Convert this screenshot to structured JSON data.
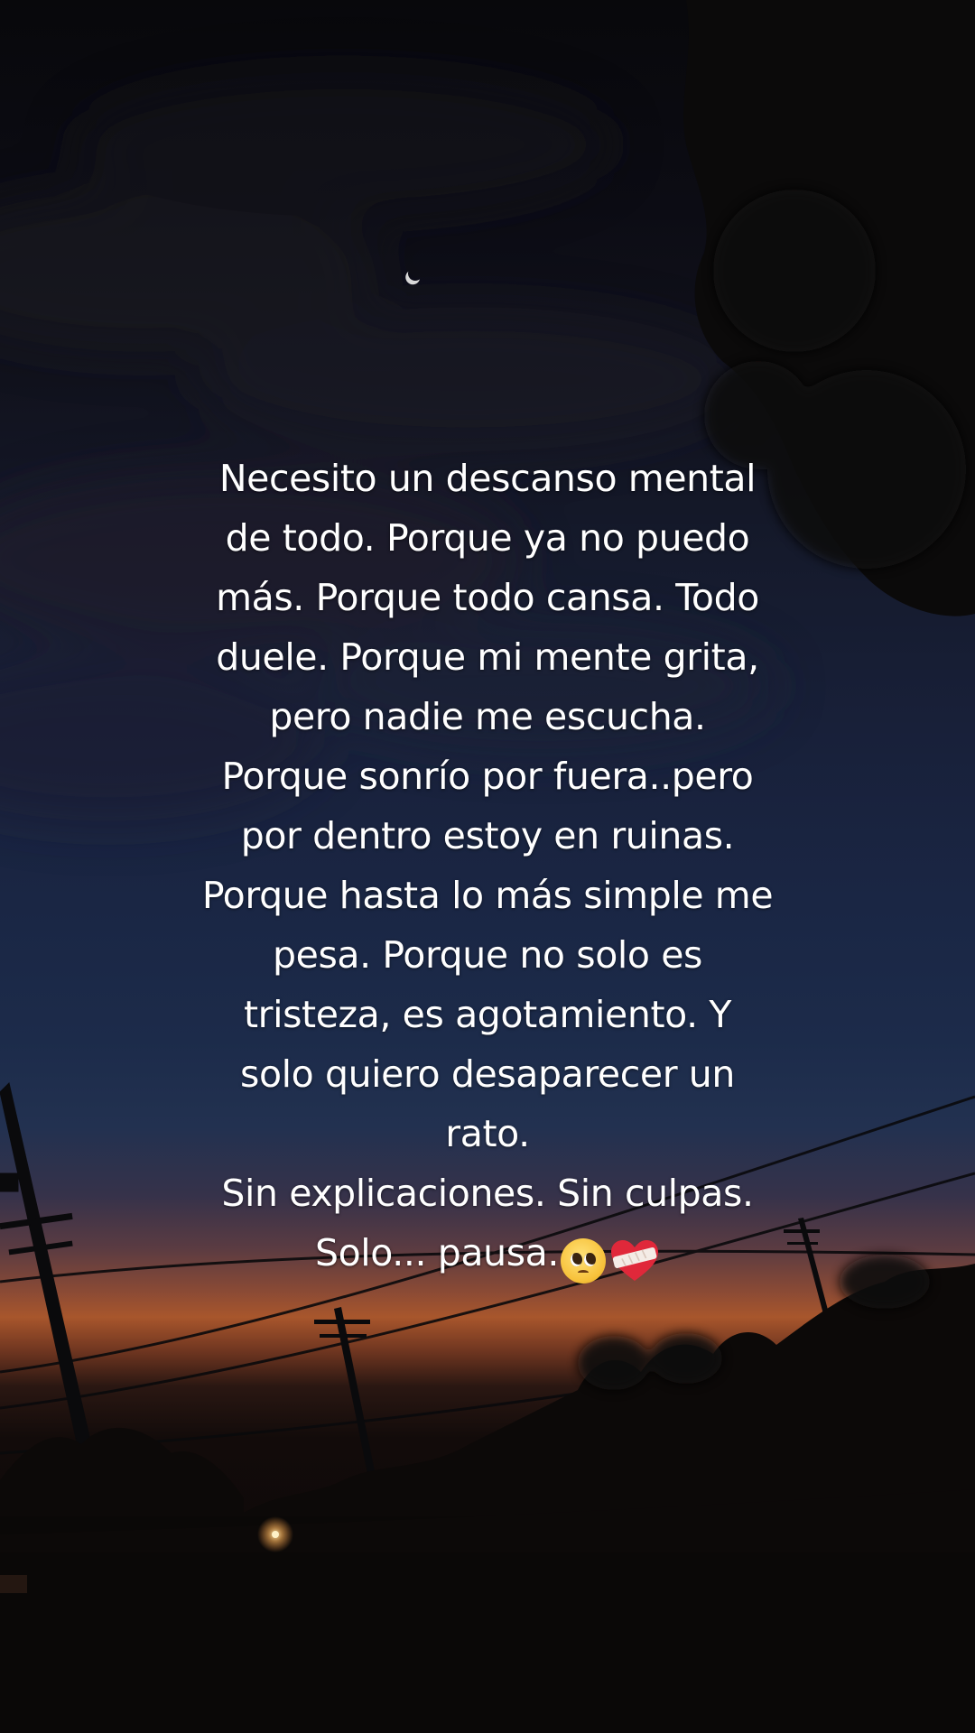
{
  "quote": {
    "text": "Necesito un descanso mental\nde todo. Porque ya no puedo\nmás. Porque todo cansa. Todo\nduele. Porque mi mente grita,\npero nadie me escucha.\nPorque sonrío por fuera..pero\npor dentro estoy en ruinas.\nPorque hasta lo más simple me\npesa. Porque no solo es\ntristeza, es agotamiento. Y\nsolo quiero desaparecer un\nrato.\nSin explicaciones. Sin culpas.\nSolo... pausa.",
    "emojis": [
      "pleading-face-icon",
      "mending-heart-icon"
    ]
  },
  "colors": {
    "text": "#ffffff",
    "sky_top": "#08080b",
    "sky_mid": "#1c2b4a",
    "horizon_glow": "#a8562c",
    "ground": "#0a0807"
  }
}
